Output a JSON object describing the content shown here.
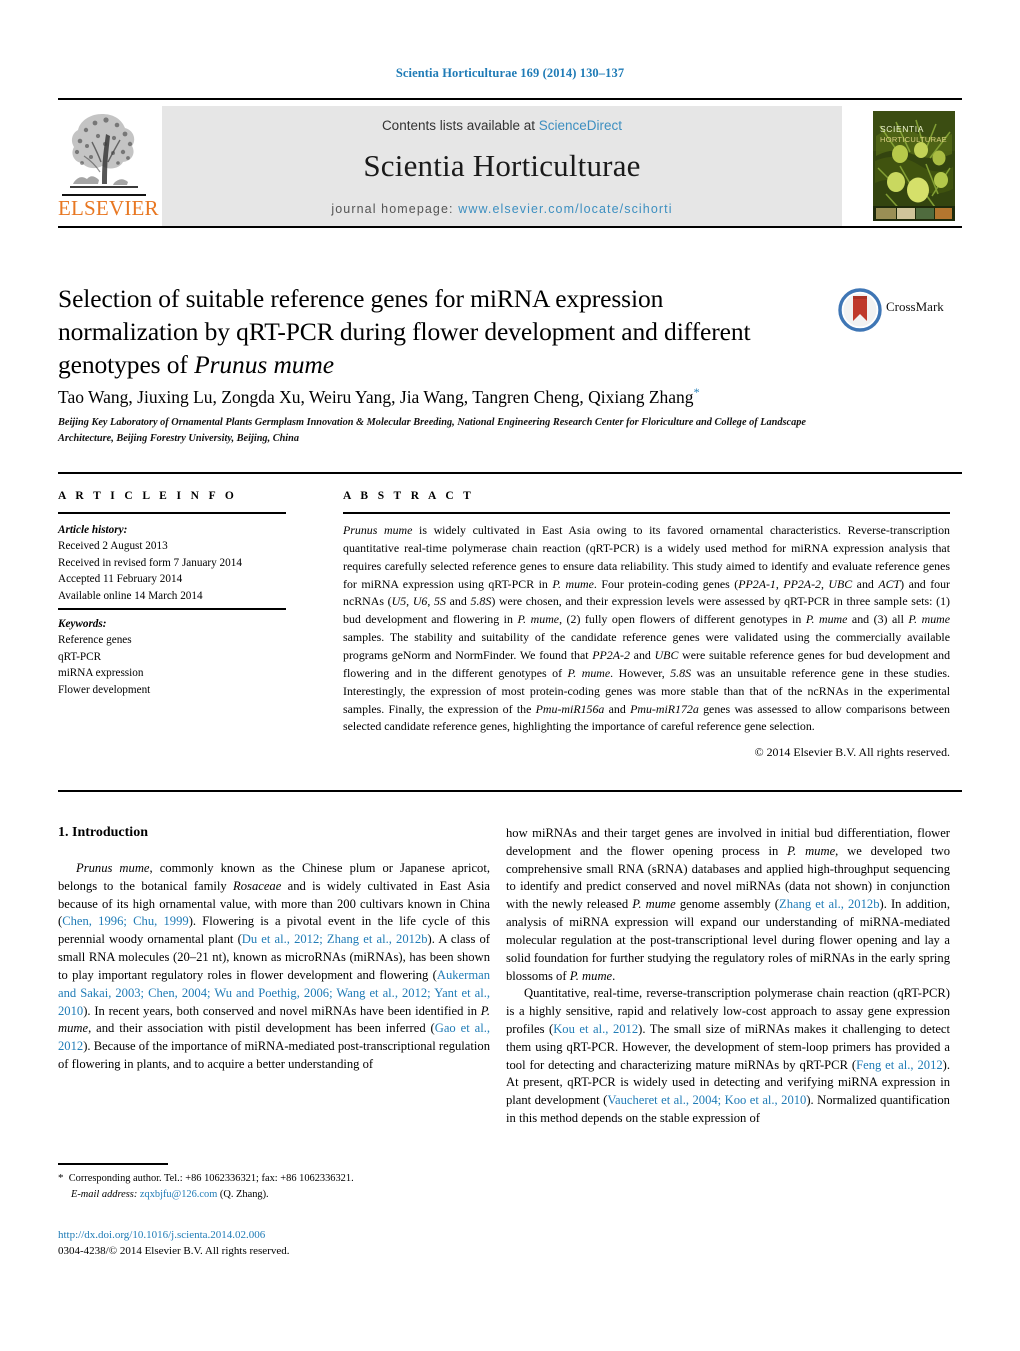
{
  "running_head": "Scientia Horticulturae 169 (2014) 130–137",
  "masthead": {
    "contents_prefix": "Contents lists available at ",
    "sciencedirect": "ScienceDirect",
    "journal_title": "Scientia Horticulturae",
    "homepage_prefix": "journal homepage:",
    "homepage_url": "www.elsevier.com/locate/scihorti",
    "publisher": "ELSEVIER",
    "cover_line1": "SCIENTIA",
    "cover_line2": "HORTICULTURAE",
    "link_color": "#3d8fc0",
    "publisher_color": "#E87722",
    "band_color": "#e6e6e6"
  },
  "article": {
    "title_part1": "Selection of suitable reference genes for miRNA expression normalization by qRT-PCR during flower development and different genotypes of ",
    "title_italic": "Prunus mume",
    "authors": "Tao Wang, Jiuxing Lu, Zongda Xu, Weiru Yang, Jia Wang, Tangren Cheng, Qixiang Zhang",
    "author_star": "*",
    "affiliation": "Beijing Key Laboratory of Ornamental Plants Germplasm Innovation & Molecular Breeding, National Engineering Research Center for Floriculture and College of Landscape Architecture, Beijing Forestry University, Beijing, China",
    "crossmark_label": "CrossMark"
  },
  "info": {
    "heading": "A R T I C L E   I N F O",
    "history_heading": "Article history:",
    "history": [
      "Received 2 August 2013",
      "Received in revised form 7 January 2014",
      "Accepted 11 February 2014",
      "Available online 14 March 2014"
    ],
    "keywords_heading": "Keywords:",
    "keywords": [
      "Reference genes",
      "qRT-PCR",
      "miRNA expression",
      "Flower development"
    ]
  },
  "abstract": {
    "heading": "A B S T R A C T",
    "text_html": "<span class=\"it\">Prunus mume</span> is widely cultivated in East Asia owing to its favored ornamental characteristics. Reverse-transcription quantitative real-time polymerase chain reaction (qRT-PCR) is a widely used method for miRNA expression analysis that requires carefully selected reference genes to ensure data reliability. This study aimed to identify and evaluate reference genes for miRNA expression using qRT-PCR in <span class=\"it\">P. mume</span>. Four protein-coding genes (<span class=\"it\">PP2A-1</span>, <span class=\"it\">PP2A-2</span>, <span class=\"it\">UBC</span> and <span class=\"it\">ACT</span>) and four ncRNAs (<span class=\"it\">U5</span>, <span class=\"it\">U6</span>, <span class=\"it\">5S</span> and <span class=\"it\">5.8S</span>) were chosen, and their expression levels were assessed by qRT-PCR in three sample sets: (1) bud development and flowering in <span class=\"it\">P. mume</span>, (2) fully open flowers of different genotypes in <span class=\"it\">P. mume</span> and (3) all <span class=\"it\">P. mume</span> samples. The stability and suitability of the candidate reference genes were validated using the commercially available programs geNorm and NormFinder. We found that <span class=\"it\">PP2A-2</span> and <span class=\"it\">UBC</span> were suitable reference genes for bud development and flowering and in the different genotypes of <span class=\"it\">P. mume</span>. However, <span class=\"it\">5.8S</span> was an unsuitable reference gene in these studies. Interestingly, the expression of most protein-coding genes was more stable than that of the ncRNAs in the experimental samples. Finally, the expression of the <span class=\"it\">Pmu-miR156a</span> and <span class=\"it\">Pmu-miR172a</span> genes was assessed to allow comparisons between selected candidate reference genes, highlighting the importance of careful reference gene selection.",
    "copyright": "© 2014 Elsevier B.V. All rights reserved."
  },
  "body": {
    "section_heading": "1.  Introduction",
    "left_para1_html": "<span class=\"it\">Prunus mume</span>, commonly known as the Chinese plum or Japanese apricot, belongs to the botanical family <span class=\"it\">Rosaceae</span> and is widely cultivated in East Asia because of its high ornamental value, with more than 200 cultivars known in China (<span class=\"ref\">Chen, 1996; Chu, 1999</span>). Flowering is a pivotal event in the life cycle of this perennial woody ornamental plant (<span class=\"ref\">Du et al., 2012; Zhang et al., 2012b</span>). A class of small RNA molecules (20–21 nt), known as microRNAs (miRNAs), has been shown to play important regulatory roles in flower development and flowering (<span class=\"ref\">Aukerman and Sakai, 2003; Chen, 2004; Wu and Poethig, 2006; Wang et al., 2012; Yant et al., 2010</span>). In recent years, both conserved and novel miRNAs have been identified in <span class=\"it\">P. mume</span>, and their association with pistil development has been inferred (<span class=\"ref\">Gao et al., 2012</span>). Because of the importance of miRNA-mediated post-transcriptional regulation of flowering in plants, and to acquire a better understanding of",
    "right_para1_html": "how miRNAs and their target genes are involved in initial bud differentiation, flower development and the flower opening process in <span class=\"it\">P. mume</span>, we developed two comprehensive small RNA (sRNA) databases and applied high-throughput sequencing to identify and predict conserved and novel miRNAs (data not shown) in conjunction with the newly released <span class=\"it\">P. mume</span> genome assembly (<span class=\"ref\">Zhang et al., 2012b</span>). In addition, analysis of miRNA expression will expand our understanding of miRNA-mediated molecular regulation at the post-transcriptional level during flower opening and lay a solid foundation for further studying the regulatory roles of miRNAs in the early spring blossoms of <span class=\"it\">P. mume</span>.",
    "right_para2_html": "Quantitative, real-time, reverse-transcription polymerase chain reaction (qRT-PCR) is a highly sensitive, rapid and relatively low-cost approach to assay gene expression profiles (<span class=\"ref\">Kou et al., 2012</span>). The small size of miRNAs makes it challenging to detect them using qRT-PCR. However, the development of stem-loop primers has provided a tool for detecting and characterizing mature miRNAs by qRT-PCR (<span class=\"ref\">Feng et al., 2012</span>). At present, qRT-PCR is widely used in detecting and verifying miRNA expression in plant development (<span class=\"ref\">Vaucheret et al., 2004; Koo et al., 2010</span>). Normalized quantification in this method depends on the stable expression of"
  },
  "footer": {
    "corresponding_html": "<span class=\"star\">*</span>&nbsp; Corresponding author. Tel.: +86 1062336321; fax: +86 1062336321.",
    "email_label": "E-mail address:",
    "email": "zqxbjfu@126.com",
    "email_owner": "(Q. Zhang).",
    "doi": "http://dx.doi.org/10.1016/j.scienta.2014.02.006",
    "issn_line": "0304-4238/© 2014 Elsevier B.V. All rights reserved."
  }
}
